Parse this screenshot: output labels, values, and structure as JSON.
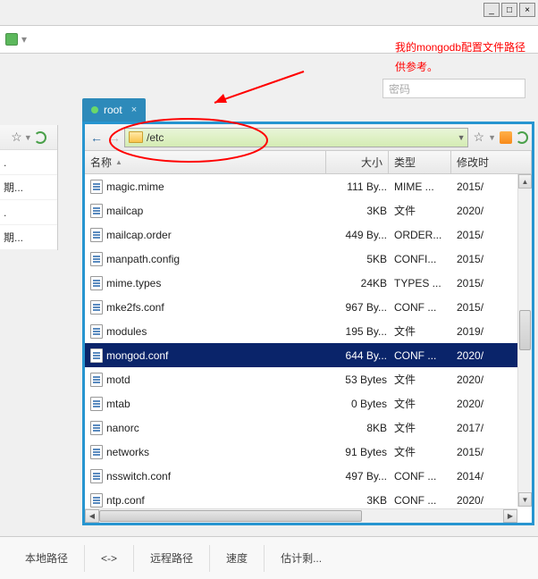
{
  "window_controls": {
    "min": "_",
    "max": "□",
    "close": "×"
  },
  "annotation": {
    "line1": "我的mongodb配置文件路径",
    "line2": "供参考。"
  },
  "password_placeholder": "密码",
  "tab": {
    "label": "root",
    "close": "×"
  },
  "path": "/etc",
  "sidebar_items": [
    ".",
    "期...",
    ".",
    "期..."
  ],
  "columns": {
    "name": "名称",
    "size": "大小",
    "type": "类型",
    "modified": "修改时"
  },
  "files": [
    {
      "name": "magic.mime",
      "size": "111 By...",
      "type": "MIME ...",
      "date": "2015/",
      "selected": false
    },
    {
      "name": "mailcap",
      "size": "3KB",
      "type": "文件",
      "date": "2020/",
      "selected": false
    },
    {
      "name": "mailcap.order",
      "size": "449 By...",
      "type": "ORDER...",
      "date": "2015/",
      "selected": false
    },
    {
      "name": "manpath.config",
      "size": "5KB",
      "type": "CONFI...",
      "date": "2015/",
      "selected": false
    },
    {
      "name": "mime.types",
      "size": "24KB",
      "type": "TYPES ...",
      "date": "2015/",
      "selected": false
    },
    {
      "name": "mke2fs.conf",
      "size": "967 By...",
      "type": "CONF ...",
      "date": "2015/",
      "selected": false
    },
    {
      "name": "modules",
      "size": "195 By...",
      "type": "文件",
      "date": "2019/",
      "selected": false
    },
    {
      "name": "mongod.conf",
      "size": "644 By...",
      "type": "CONF ...",
      "date": "2020/",
      "selected": true
    },
    {
      "name": "motd",
      "size": "53 Bytes",
      "type": "文件",
      "date": "2020/",
      "selected": false
    },
    {
      "name": "mtab",
      "size": "0 Bytes",
      "type": "文件",
      "date": "2020/",
      "selected": false
    },
    {
      "name": "nanorc",
      "size": "8KB",
      "type": "文件",
      "date": "2017/",
      "selected": false
    },
    {
      "name": "networks",
      "size": "91 Bytes",
      "type": "文件",
      "date": "2015/",
      "selected": false
    },
    {
      "name": "nsswitch.conf",
      "size": "497 By...",
      "type": "CONF ...",
      "date": "2014/",
      "selected": false
    },
    {
      "name": "ntp.conf",
      "size": "3KB",
      "type": "CONF ...",
      "date": "2020/",
      "selected": false
    }
  ],
  "status": {
    "local_path": "本地路径",
    "arrows": "<->",
    "remote_path": "远程路径",
    "speed": "速度",
    "eta": "估计剩..."
  }
}
